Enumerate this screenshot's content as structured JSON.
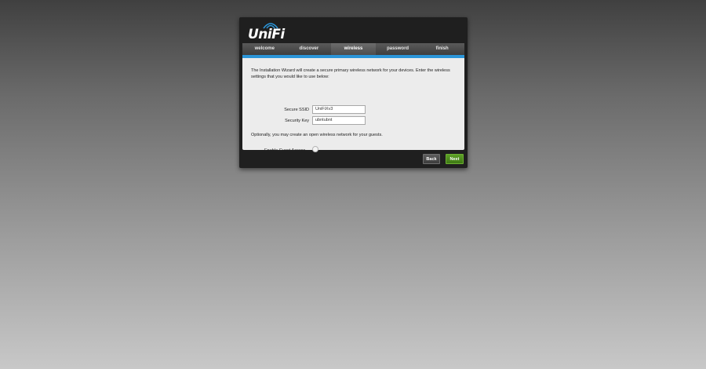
{
  "app": {
    "logo_text": "UniFi"
  },
  "tabs": [
    {
      "label": "welcome",
      "active": false
    },
    {
      "label": "discover",
      "active": false
    },
    {
      "label": "wireless",
      "active": true
    },
    {
      "label": "password",
      "active": false
    },
    {
      "label": "finish",
      "active": false
    }
  ],
  "wireless": {
    "intro": "The Installation Wizard will create a secure primary wireless network for your devices. Enter the wireless settings that you would like to use below:",
    "ssid_label": "Secure SSID",
    "ssid_value": "UniFiXv3",
    "key_label": "Security Key",
    "key_value": "ubntubnt",
    "optional_text": "Optionally, you may create an open wireless network for your guests.",
    "guest_label": "Enable Guest Access",
    "guest_enabled": false
  },
  "buttons": {
    "back": "Back",
    "next": "Next"
  },
  "colors": {
    "accent": "#2b95d8",
    "next_button": "#4e8c1d",
    "panel": "#1f1f1f"
  }
}
